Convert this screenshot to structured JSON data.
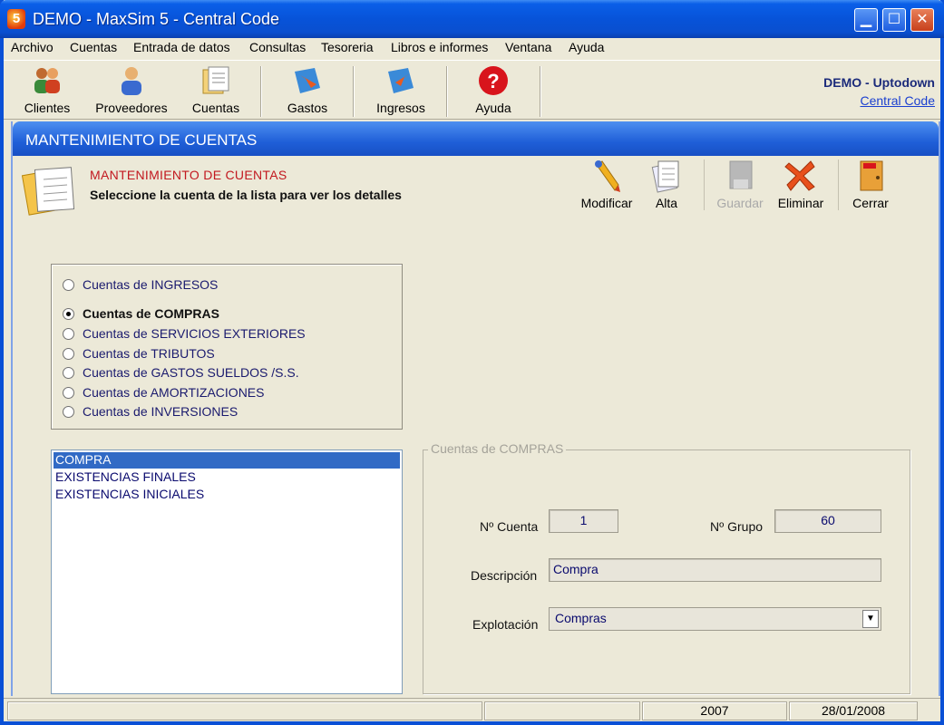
{
  "window": {
    "title": "DEMO - MaxSim 5 - Central Code",
    "logo_char": "5"
  },
  "menu": [
    "Archivo",
    "Cuentas",
    "Entrada de datos",
    "Consultas",
    "Tesoreria",
    "Libros e informes",
    "Ventana",
    "Ayuda"
  ],
  "toolbar": {
    "clientes": "Clientes",
    "proveedores": "Proveedores",
    "cuentas": "Cuentas",
    "gastos": "Gastos",
    "ingresos": "Ingresos",
    "ayuda": "Ayuda"
  },
  "brand": {
    "company": "DEMO - Uptodown",
    "link": "Central Code"
  },
  "panel": {
    "heading": "MANTENIMIENTO DE CUENTAS",
    "title": "MANTENIMIENTO DE CUENTAS",
    "subtitle": "Seleccione la cuenta de la lista para ver los detalles"
  },
  "actions": {
    "modificar": "Modificar",
    "alta": "Alta",
    "guardar": "Guardar",
    "eliminar": "Eliminar",
    "cerrar": "Cerrar"
  },
  "account_types": [
    {
      "label": "Cuentas de INGRESOS",
      "selected": false
    },
    {
      "label": "Cuentas de COMPRAS",
      "selected": true
    },
    {
      "label": "Cuentas de SERVICIOS EXTERIORES",
      "selected": false
    },
    {
      "label": "Cuentas de TRIBUTOS",
      "selected": false
    },
    {
      "label": "Cuentas de GASTOS SUELDOS /S.S.",
      "selected": false
    },
    {
      "label": "Cuentas de AMORTIZACIONES",
      "selected": false
    },
    {
      "label": "Cuentas de INVERSIONES",
      "selected": false
    }
  ],
  "accounts": [
    "COMPRA",
    "EXISTENCIAS FINALES",
    "EXISTENCIAS INICIALES"
  ],
  "details": {
    "legend": "Cuentas de COMPRAS",
    "num_cuenta_label": "Nº Cuenta",
    "num_cuenta": "1",
    "num_grupo_label": "Nº Grupo",
    "num_grupo": "60",
    "descripcion_label": "Descripción",
    "descripcion": "Compra",
    "explotacion_label": "Explotación",
    "explotacion": "Compras"
  },
  "status": {
    "year": "2007",
    "date": "28/01/2008"
  },
  "colors": {
    "titlebar": "#0753d9",
    "header_red": "#c2181f",
    "selection": "#316ac5",
    "link": "#1a3fd0"
  }
}
